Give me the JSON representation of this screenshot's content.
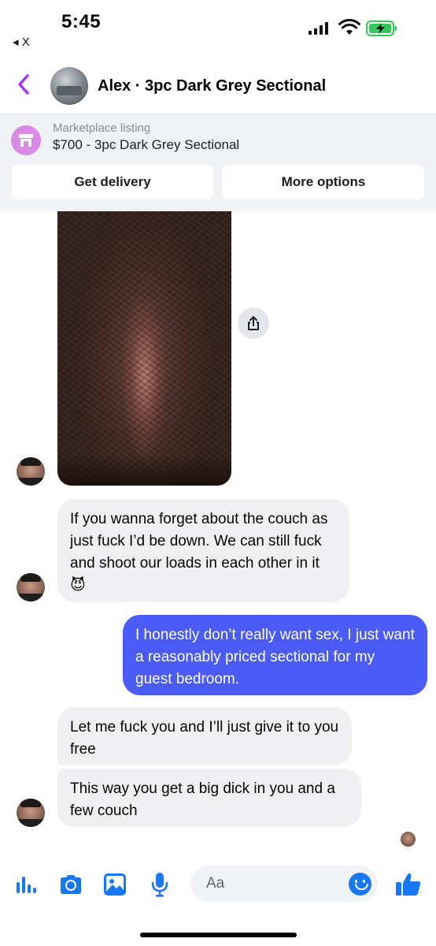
{
  "status_bar": {
    "time": "5:45",
    "back_app": "◂ X",
    "battery_color": "#34c759"
  },
  "header": {
    "title": "Alex · 3pc Dark Grey Sectional",
    "accent_color": "#a033ff"
  },
  "listing": {
    "label": "Marketplace listing",
    "title": "$700 - 3pc Dark Grey Sectional",
    "icon": "storefront-icon",
    "buttons": {
      "delivery": "Get delivery",
      "options": "More options"
    }
  },
  "messages": [
    {
      "from": "Alex",
      "text": "If you wanna forget about the couch as just fuck I’d be down. We can still fuck and shoot our loads in each other in it 😈"
    },
    {
      "from": "me",
      "text": "I honestly don’t really want sex, I just want a reasonably priced sectional for my guest bedroom."
    },
    {
      "from": "Alex",
      "text": "Let me fuck you and I’ll just give it to you free"
    },
    {
      "from": "Alex",
      "text": "This way you get a big dick in you and a few couch"
    }
  ],
  "composer": {
    "placeholder": "Aa",
    "icons": [
      "apps-icon",
      "camera-icon",
      "gallery-icon",
      "microphone-icon",
      "emoji-icon",
      "thumbs-up-icon"
    ],
    "icon_color": "#1877f2"
  },
  "colors": {
    "outgoing_bubble": "#4a5cf5",
    "incoming_bubble": "#f0f0f2"
  }
}
